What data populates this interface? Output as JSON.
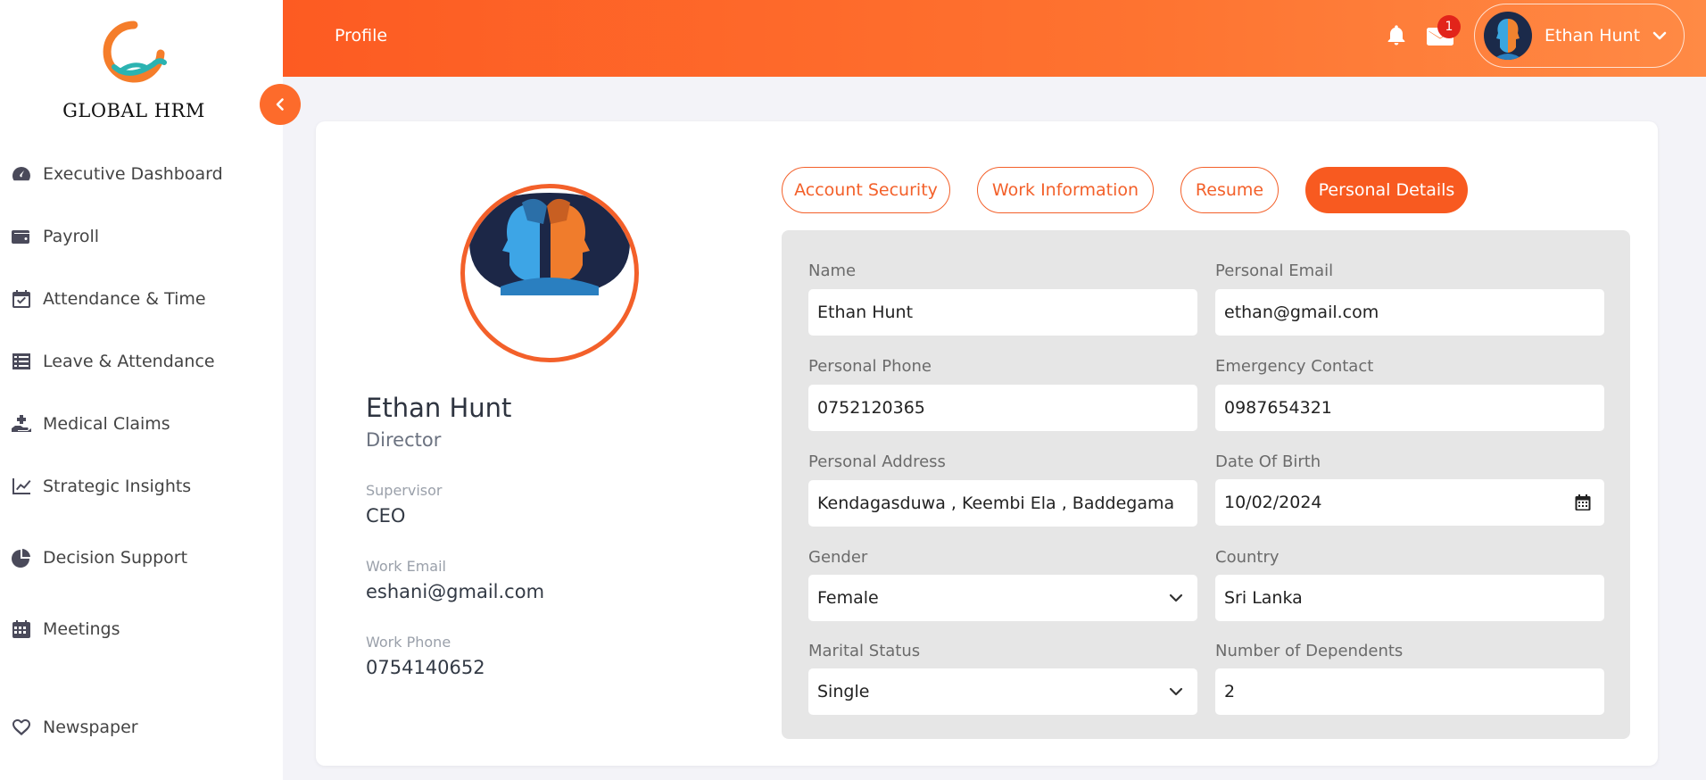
{
  "brand": {
    "name": "GLOBAL HRM"
  },
  "sidebar": {
    "items": [
      {
        "label": "Executive Dashboard",
        "icon": "gauge-icon"
      },
      {
        "label": "Payroll",
        "icon": "wallet-icon"
      },
      {
        "label": "Attendance & Time",
        "icon": "calendar-check-icon"
      },
      {
        "label": "Leave & Attendance",
        "icon": "list-icon"
      },
      {
        "label": "Medical Claims",
        "icon": "hand-medical-icon"
      },
      {
        "label": "Strategic Insights",
        "icon": "chart-line-icon"
      },
      {
        "label": "Decision Support",
        "icon": "pie-chart-icon"
      },
      {
        "label": "Meetings",
        "icon": "calendar-icon"
      },
      {
        "label": "Newspaper",
        "icon": "heart-icon"
      }
    ]
  },
  "topbar": {
    "title": "Profile",
    "notification_count": "1",
    "user_name": "Ethan Hunt"
  },
  "profile": {
    "name": "Ethan Hunt",
    "role": "Director",
    "supervisor_label": "Supervisor",
    "supervisor": "CEO",
    "work_email_label": "Work Email",
    "work_email": "eshani@gmail.com",
    "work_phone_label": "Work Phone",
    "work_phone": "0754140652"
  },
  "tabs": {
    "account_security": "Account Security",
    "work_information": "Work Information",
    "resume": "Resume",
    "personal_details": "Personal Details",
    "active": "Personal Details"
  },
  "form": {
    "name_label": "Name",
    "name": "Ethan Hunt",
    "personal_email_label": "Personal Email",
    "personal_email": "ethan@gmail.com",
    "personal_phone_label": "Personal Phone",
    "personal_phone": "0752120365",
    "emergency_contact_label": "Emergency Contact",
    "emergency_contact": "0987654321",
    "personal_address_label": "Personal Address",
    "personal_address": "Kendagasduwa , Keembi Ela , Baddegama",
    "dob_label": "Date Of Birth",
    "dob": "10/02/2024",
    "gender_label": "Gender",
    "gender": "Female",
    "country_label": "Country",
    "country": "Sri Lanka",
    "marital_status_label": "Marital Status",
    "marital_status": "Single",
    "dependents_label": "Number of Dependents",
    "dependents": "2"
  },
  "colors": {
    "accent": "#f85a20",
    "topbar_start": "#fd5b22",
    "topbar_end": "#ff8a45",
    "badge": "#e2241a"
  }
}
